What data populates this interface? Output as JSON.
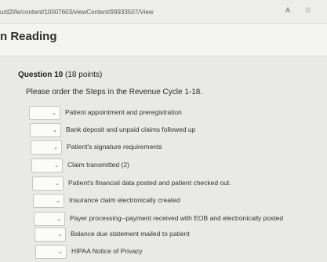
{
  "browser": {
    "url": "u/d2l/le/content/10007603/viewContent/99933507/View",
    "read_mode_icon": "A",
    "favorite_icon": "☆"
  },
  "page": {
    "title": "n Reading"
  },
  "question": {
    "number_label": "Question 10",
    "points": "(18 points)",
    "prompt": "Please order the Steps in the Revenue Cycle 1-18."
  },
  "items": [
    {
      "label": "Patient appointment and preregistration",
      "selected": ""
    },
    {
      "label": "Bank deposit and unpaid claims followed up",
      "selected": ""
    },
    {
      "label": "Patient's signature requirements",
      "selected": ""
    },
    {
      "label": "Claim transmitted (2)",
      "selected": ""
    },
    {
      "label": "Patient's financial data posted and patient checked out.",
      "selected": ""
    },
    {
      "label": "Insurance claim electronically created",
      "selected": ""
    },
    {
      "label": "Payer processing--payment received with EOB and electronically posted",
      "selected": ""
    },
    {
      "label": "Balance due statement mailed to patient",
      "selected": ""
    },
    {
      "label": "HIPAA Notice of Privacy",
      "selected": ""
    }
  ],
  "icons": {
    "dropdown": "chevron-down-icon"
  }
}
